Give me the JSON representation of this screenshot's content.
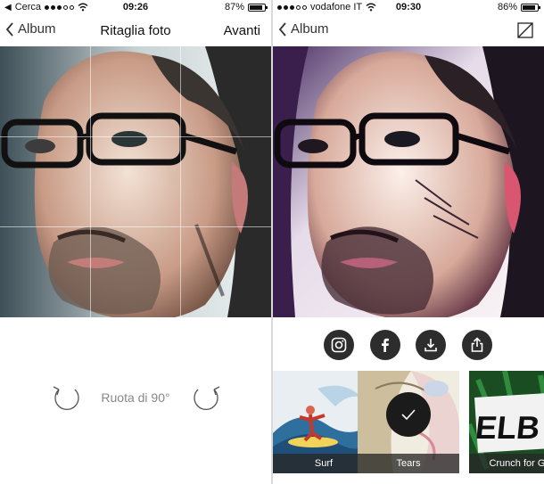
{
  "left": {
    "status": {
      "carrier": "Cerca",
      "time": "09:26",
      "battery": "87%",
      "battery_level": 0.87
    },
    "nav": {
      "back_label": "Album",
      "title": "Ritaglia foto",
      "action_label": "Avanti"
    },
    "rotate": {
      "label": "Ruota di 90°"
    }
  },
  "right": {
    "status": {
      "carrier": "vodafone IT",
      "time": "09:30",
      "battery": "86%",
      "battery_level": 0.86
    },
    "nav": {
      "back_label": "Album"
    },
    "share_buttons": [
      {
        "icon": "instagram-icon"
      },
      {
        "icon": "facebook-icon"
      },
      {
        "icon": "download-icon"
      },
      {
        "icon": "share-icon"
      }
    ],
    "filters": [
      {
        "name": "Surf",
        "selected": false
      },
      {
        "name": "Tears",
        "selected": true
      },
      {
        "name": "Crunch for Go"
      }
    ]
  },
  "colors": {
    "button_dark": "#2d2d2d",
    "label_bar": "#282828",
    "accent_green": "#3aa64a"
  }
}
